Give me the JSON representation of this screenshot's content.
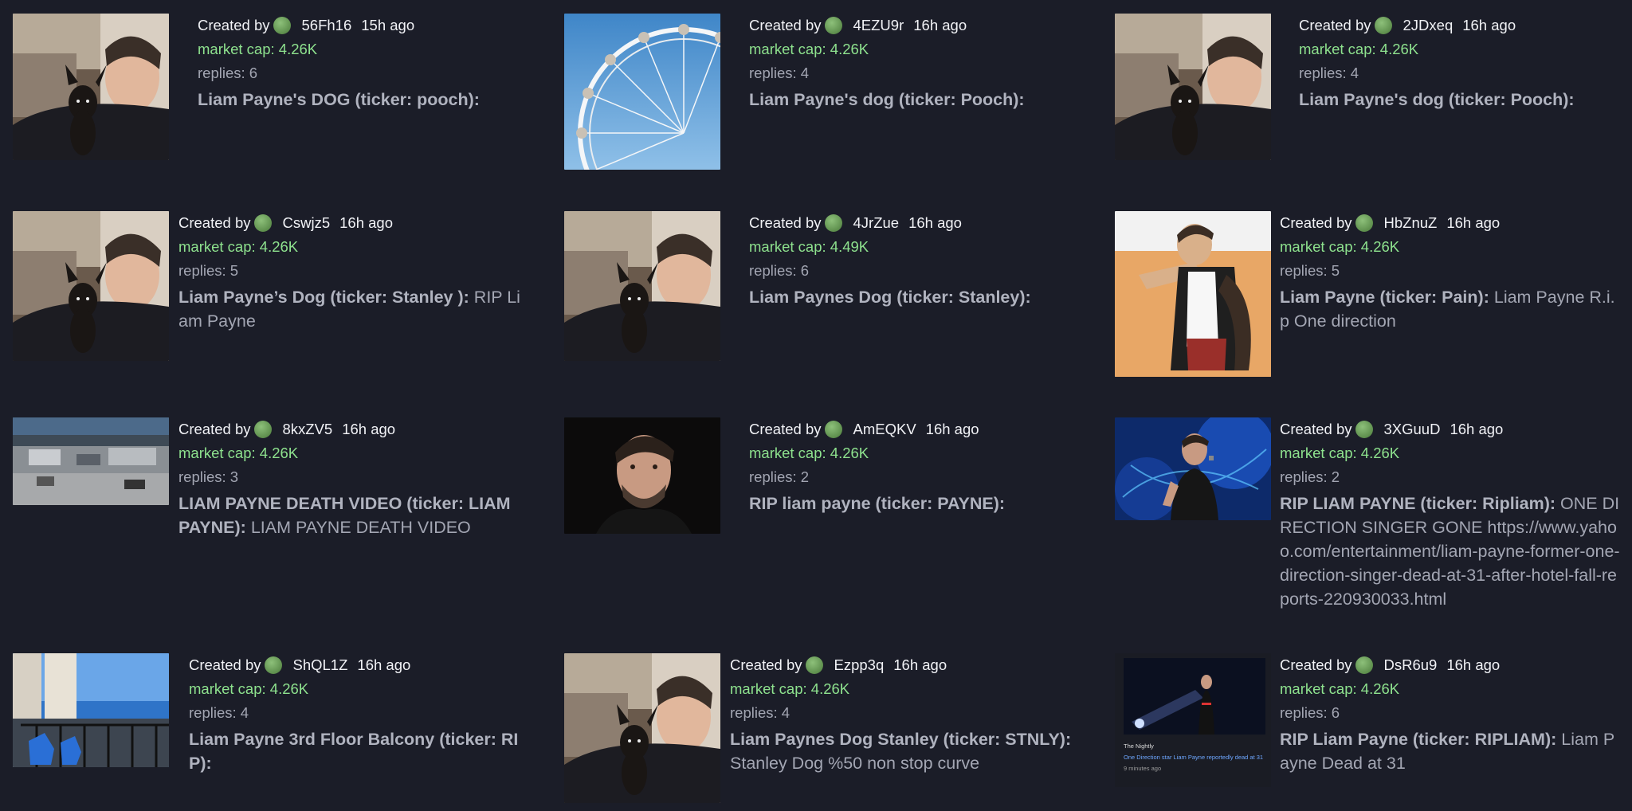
{
  "labels": {
    "created_by": "Created by",
    "market_cap_prefix": "market cap: ",
    "replies_prefix": "replies: "
  },
  "colors": {
    "background": "#1b1d28",
    "market_cap": "#8ee28e",
    "muted": "#a3a6b3"
  },
  "cards": [
    {
      "user": "56Fh16",
      "ago": "15h ago",
      "market_cap": "4.26K",
      "replies": "6",
      "name": "Liam Payne's DOG (ticker: pooch):",
      "description": "",
      "image": "liam-with-dog-photo"
    },
    {
      "user": "4EZU9r",
      "ago": "16h ago",
      "market_cap": "4.26K",
      "replies": "4",
      "name": "Liam Payne's dog (ticker: Pooch):",
      "description": "",
      "image": "ferris-wheel-photo"
    },
    {
      "user": "2JDxeq",
      "ago": "16h ago",
      "market_cap": "4.26K",
      "replies": "4",
      "name": "Liam Payne's dog (ticker: Pooch):",
      "description": "",
      "image": "liam-with-dog-photo"
    },
    {
      "user": "Cswjz5",
      "ago": "16h ago",
      "market_cap": "4.26K",
      "replies": "5",
      "name": "Liam Payne’s Dog (ticker: Stanley ):",
      "description": "RIP Liam Payne",
      "image": "liam-with-dog-photo"
    },
    {
      "user": "4JrZue",
      "ago": "16h ago",
      "market_cap": "4.49K",
      "replies": "6",
      "name": "Liam Paynes Dog (ticker: Stanley):",
      "description": "",
      "image": "liam-with-dog-photo"
    },
    {
      "user": "HbZnuZ",
      "ago": "16h ago",
      "market_cap": "4.26K",
      "replies": "5",
      "name": "Liam Payne (ticker: Pain):",
      "description": "Liam Payne R.i.p One direction",
      "image": "cartoon-illustration"
    },
    {
      "user": "8kxZV5",
      "ago": "16h ago",
      "market_cap": "4.26K",
      "replies": "3",
      "name": "LIAM PAYNE DEATH VIDEO (ticker: LIAM PAYNE):",
      "description": "LIAM PAYNE DEATH VIDEO",
      "image": "street-scene-photo"
    },
    {
      "user": "AmEQKV",
      "ago": "16h ago",
      "market_cap": "4.26K",
      "replies": "2",
      "name": "RIP liam payne (ticker: PAYNE):",
      "description": "",
      "image": "portrait-photo"
    },
    {
      "user": "3XGuuD",
      "ago": "16h ago",
      "market_cap": "4.26K",
      "replies": "2",
      "name": "RIP LIAM PAYNE (ticker: Ripliam):",
      "description": "ONE DIRECTION SINGER GONE https://www.yahoo.com/entertainment/liam-payne-former-one-direction-singer-dead-at-31-after-hotel-fall-reports-220930033.html",
      "image": "concert-photo"
    },
    {
      "user": "ShQL1Z",
      "ago": "16h ago",
      "market_cap": "4.26K",
      "replies": "4",
      "name": "Liam Payne 3rd Floor Balcony (ticker: RIP):",
      "description": "",
      "image": "balcony-photo"
    },
    {
      "user": "Ezpp3q",
      "ago": "16h ago",
      "market_cap": "4.26K",
      "replies": "4",
      "name": "Liam Paynes Dog Stanley (ticker: STNLY):",
      "description": "Stanley Dog %50 non stop curve",
      "image": "liam-with-dog-photo"
    },
    {
      "user": "DsR6u9",
      "ago": "16h ago",
      "market_cap": "4.26K",
      "replies": "6",
      "name": "RIP Liam Payne (ticker: RIPLIAM):",
      "description": "Liam Payne Dead at 31",
      "image": "news-screenshot"
    }
  ],
  "news_card": {
    "source": "The Nightly",
    "headline": "One Direction star Liam Payne reportedly dead at 31",
    "time": "9 minutes ago"
  }
}
